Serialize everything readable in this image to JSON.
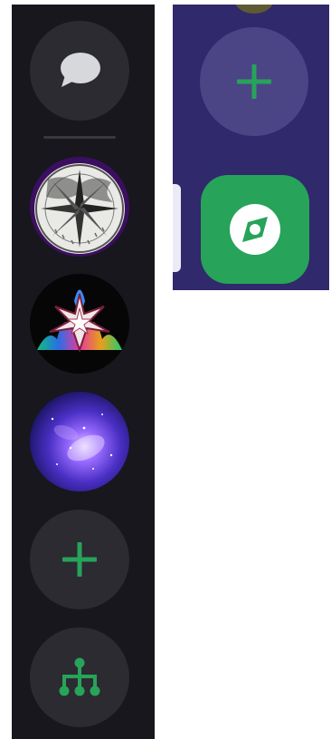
{
  "sidebar": {
    "direct_messages": {
      "icon": "chat-bubble-icon"
    },
    "servers": [
      {
        "icon": "compass-rose-sketch-server-icon"
      },
      {
        "icon": "rainbow-star-server-icon"
      },
      {
        "icon": "purple-galaxy-server-icon"
      }
    ],
    "add_server": {
      "icon": "plus-icon"
    },
    "discover": {
      "icon": "hierarchy-icon"
    }
  },
  "panel": {
    "add_server": {
      "icon": "plus-icon"
    },
    "explore": {
      "icon": "compass-icon"
    }
  },
  "colors": {
    "rail_background": "#17171d",
    "button_background": "#2b2b31",
    "accent_green": "#27a35a",
    "panel_background": "#30296b"
  }
}
